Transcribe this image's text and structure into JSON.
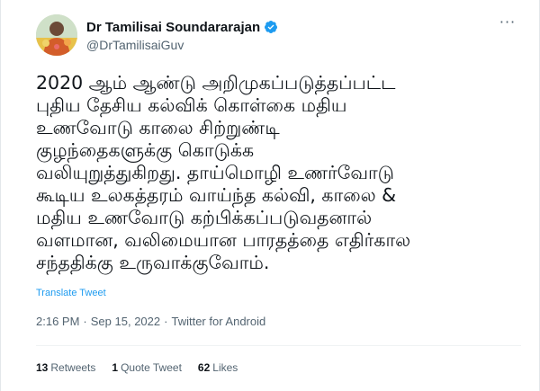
{
  "author": {
    "display_name": "Dr Tamilisai Soundararajan",
    "handle": "@DrTamilisaiGuv",
    "verified": true
  },
  "tweet": {
    "lines": [
      "2020 ஆம் ஆண்டு அறிமுகப்படுத்தப்பட்ட",
      "புதிய தேசிய கல்விக் கொள்கை மதிய",
      "உணவோடு காலை சிற்றுண்டி",
      "குழந்தைகளுக்கு கொடுக்க",
      "வலியுறுத்துகிறது. தாய்மொழி உணர்வோடு",
      "கூடிய உலகத்தரம் வாய்ந்த கல்வி, காலை &",
      "மதிய உணவோடு கற்பிக்கப்படுவதனால்",
      "வளமான, வலிமையான பாரதத்தை எதிர்கால",
      "சந்ததிக்கு உருவாக்குவோம்."
    ],
    "translate_label": "Translate Tweet",
    "time": "2:16 PM",
    "date": "Sep 15, 2022",
    "source": "Twitter for Android",
    "separator": "·"
  },
  "stats": {
    "retweets_count": "13",
    "retweets_label": "Retweets",
    "quotes_count": "1",
    "quotes_label": "Quote Tweet",
    "likes_count": "62",
    "likes_label": "Likes"
  },
  "icons": {
    "more": "more-horizontal-icon",
    "verified": "verified-badge-icon"
  },
  "colors": {
    "link": "#1d9bf0",
    "secondary_text": "#536471",
    "primary_text": "#0f1419"
  }
}
